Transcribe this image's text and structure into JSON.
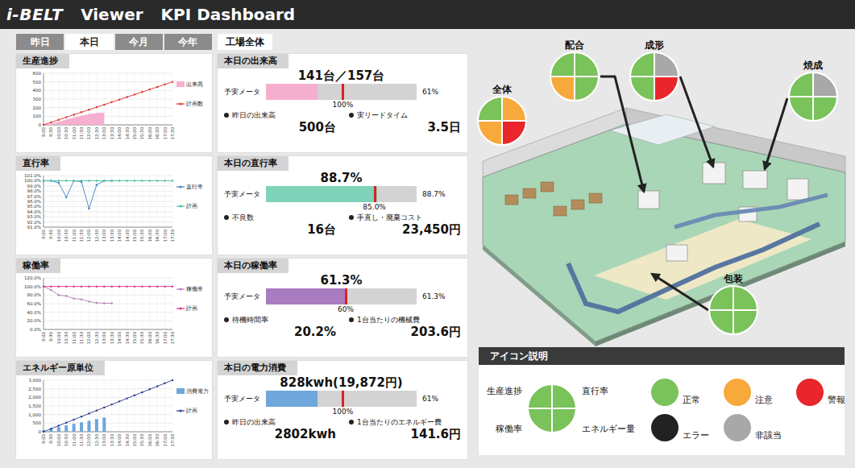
{
  "header": {
    "logo": "i-BELT",
    "app": "Viewer",
    "title": "KPI Dashboard"
  },
  "period_tabs": [
    {
      "label": "昨日",
      "selected": false
    },
    {
      "label": "本日",
      "selected": true
    },
    {
      "label": "今月",
      "selected": false
    },
    {
      "label": "今年",
      "selected": false
    }
  ],
  "scope_tab": "工場全体",
  "time_axis": [
    "9:00",
    "9:30",
    "10:00",
    "10:30",
    "11:00",
    "11:30",
    "12:00",
    "12:30",
    "13:00",
    "13:30",
    "14:00",
    "14:30",
    "15:00",
    "15:30",
    "16:00",
    "16:30",
    "17:00",
    "17:30"
  ],
  "charts": [
    {
      "title": "生産進捗",
      "y_ticks": [
        "600",
        "500",
        "400",
        "300",
        "200",
        "100",
        "0"
      ],
      "y_min": 0,
      "y_max": 600,
      "series": [
        {
          "label": "出来高",
          "kind": "area",
          "color": "#f5afcf",
          "values": [
            0,
            15,
            35,
            60,
            85,
            105,
            125,
            138,
            141
          ]
        },
        {
          "label": "計画数",
          "kind": "line",
          "color": "#e0302e",
          "values": [
            0,
            29,
            59,
            88,
            118,
            147,
            176,
            206,
            235,
            265,
            294,
            324,
            353,
            382,
            412,
            441,
            471,
            500
          ]
        }
      ]
    },
    {
      "title": "直行率",
      "y_ticks": [
        "101.0%",
        "100.0%",
        "99.0%",
        "98.0%",
        "97.0%",
        "96.0%",
        "95.0%",
        "94.0%",
        "93.0%",
        "92.0%",
        "91.0%"
      ],
      "y_min": 91,
      "y_max": 101,
      "series": [
        {
          "label": "直行率",
          "kind": "line",
          "color": "#3b82c4",
          "values": [
            100,
            100,
            99.6,
            96.8,
            100,
            99.8,
            94.6,
            99.2,
            100,
            100
          ]
        },
        {
          "label": "計画",
          "kind": "line",
          "color": "#46bfa0",
          "values": [
            100,
            100,
            100,
            100,
            100,
            100,
            100,
            100,
            100,
            100,
            100,
            100,
            100,
            100,
            100,
            100,
            100,
            100
          ]
        }
      ]
    },
    {
      "title": "稼働率",
      "y_ticks": [
        "120.0%",
        "100.0%",
        "80.0%",
        "60.0%",
        "40.0%",
        "20.0%",
        "0.0%"
      ],
      "y_min": 0,
      "y_max": 120,
      "series": [
        {
          "label": "稼働率",
          "kind": "line",
          "color": "#b07fb5",
          "values": [
            100,
            92,
            80,
            78,
            72,
            70,
            65,
            62,
            61,
            61
          ]
        },
        {
          "label": "計画",
          "kind": "line",
          "color": "#d63384",
          "values": [
            100,
            100,
            100,
            100,
            100,
            100,
            100,
            100,
            100,
            100,
            100,
            100,
            100,
            100,
            100,
            100,
            100,
            100
          ]
        }
      ]
    },
    {
      "title": "エネルギー原単位",
      "y_ticks": [
        "3,000",
        "2,500",
        "2,000",
        "1,500",
        "1,000",
        "500",
        "0"
      ],
      "y_min": 0,
      "y_max": 3000,
      "series": [
        {
          "label": "消費電力",
          "kind": "bars",
          "color": "#6ea6dc",
          "values": [
            90,
            180,
            270,
            370,
            460,
            550,
            640,
            740,
            828
          ]
        },
        {
          "label": "計画",
          "kind": "line",
          "color": "#2b3a8c",
          "values": [
            0,
            176,
            353,
            529,
            706,
            882,
            1059,
            1235,
            1412,
            1588,
            1765,
            1941,
            2118,
            2294,
            2471,
            2647,
            2824,
            3000
          ]
        }
      ]
    }
  ],
  "kpis": [
    {
      "title": "本日の出来高",
      "value": "141台／157台",
      "meter_label": "予実メータ",
      "level": 0.34,
      "target_level": 0.51,
      "target_label": "100%",
      "reading": "61%",
      "color": "#f5afcf",
      "stats": [
        {
          "label": "昨日の出来高",
          "value": "500台"
        },
        {
          "label": "実リードタイム",
          "value": "3.5日"
        }
      ]
    },
    {
      "title": "本日の直行率",
      "value": "88.7%",
      "meter_label": "予実メータ",
      "level": 0.74,
      "target_level": 0.72,
      "target_label": "85.0%",
      "reading": "88.7%",
      "color": "#7fd3b8",
      "stats": [
        {
          "label": "不良数",
          "value": "16台"
        },
        {
          "label": "手直し・廃棄コスト",
          "value": "23,450円"
        }
      ]
    },
    {
      "title": "本日の稼働率",
      "value": "61.3%",
      "meter_label": "予実メータ",
      "level": 0.53,
      "target_level": 0.53,
      "target_label": "60%",
      "reading": "61.3%",
      "color": "#a97cc0",
      "stats": [
        {
          "label": "待機時間率",
          "value": "20.2%"
        },
        {
          "label": "1台当たりの機械費",
          "value": "203.6円"
        }
      ]
    },
    {
      "title": "本日の電力消費",
      "value": "828kwh(19,872円)",
      "meter_label": "予実メータ",
      "level": 0.34,
      "target_level": 0.51,
      "target_label": "100%",
      "reading": "61%",
      "color": "#6fa6dc",
      "stats": [
        {
          "label": "昨日の出来高",
          "value": "2802kwh"
        },
        {
          "label": "1台当たりのエネルギー費",
          "value": "141.6円"
        }
      ]
    }
  ],
  "map": {
    "pies": [
      {
        "label": "全体",
        "colors": [
          "#7ac25a",
          "#f7a93b",
          "#f7a93b",
          "#e8262b"
        ]
      },
      {
        "label": "配合",
        "colors": [
          "#7ac25a",
          "#7ac25a",
          "#f7a93b",
          "#7ac25a"
        ]
      },
      {
        "label": "成形",
        "colors": [
          "#7ac25a",
          "#a8a8a8",
          "#7ac25a",
          "#e8262b"
        ]
      },
      {
        "label": "焼成",
        "colors": [
          "#7ac25a",
          "#a8a8a8",
          "#7ac25a",
          "#7ac25a"
        ]
      },
      {
        "label": "包装",
        "colors": [
          "#7ac25a",
          "#7ac25a",
          "#7ac25a",
          "#7ac25a"
        ]
      }
    ]
  },
  "legend": {
    "title": "アイコン説明",
    "quadrant_labels": [
      "生産進捗",
      "直行率",
      "稼働率",
      "エネルギー量"
    ],
    "sample_colors": [
      "#7ac25a",
      "#7ac25a",
      "#7ac25a",
      "#7ac25a"
    ],
    "statuses": [
      {
        "label": "正常",
        "color": "#7ac25a"
      },
      {
        "label": "注意",
        "color": "#f7a93b"
      },
      {
        "label": "警報",
        "color": "#e8262b"
      },
      {
        "label": "エラー",
        "color": "#222222"
      },
      {
        "label": "非該当",
        "color": "#a8a8a8"
      }
    ]
  }
}
